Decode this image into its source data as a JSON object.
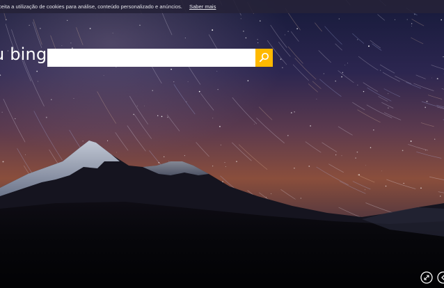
{
  "cookie_banner": {
    "text": "ceita a utilização de cookies para análise, conteúdo personalizado e anúncios.",
    "link_label": "Saber mais"
  },
  "brand": {
    "logo_text": "u bing"
  },
  "search": {
    "value": "",
    "placeholder": "",
    "button_icon": "search-icon",
    "accent_color": "#ffb900"
  },
  "controls": {
    "fullscreen_icon": "expand-icon",
    "previous_icon": "previous-arrow-icon"
  }
}
